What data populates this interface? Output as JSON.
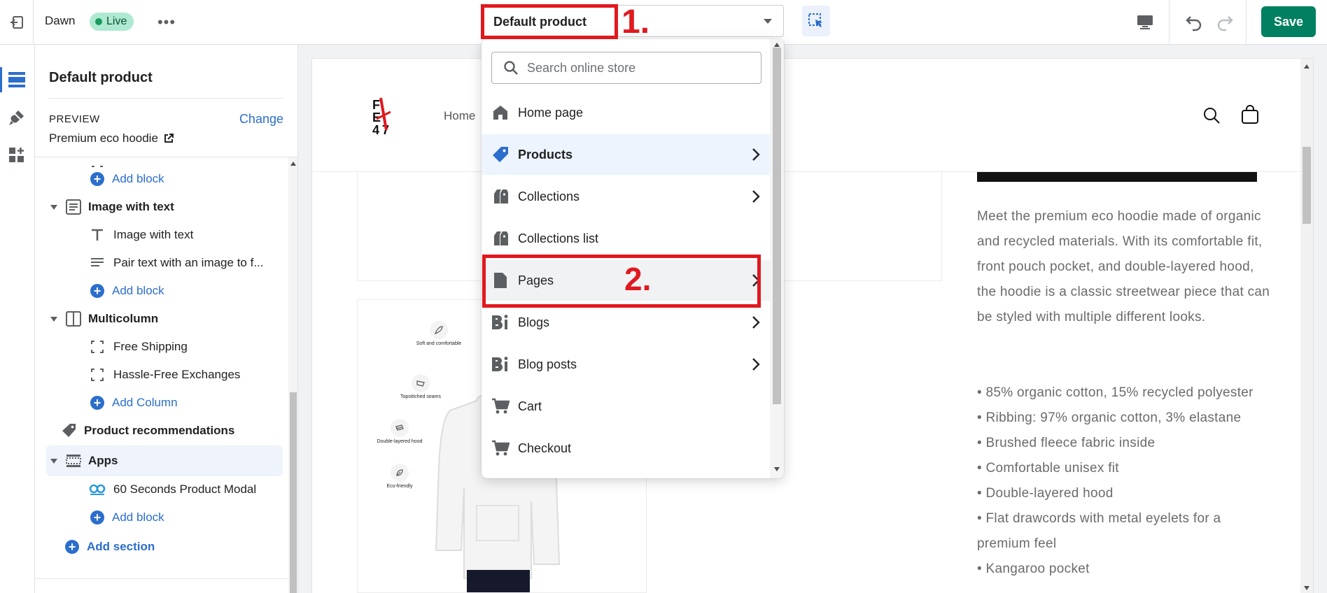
{
  "colors": {
    "accent": "#2c6ecb",
    "primary_button": "#008060",
    "annotation": "#e0191f",
    "live_badge_bg": "#aee9d1"
  },
  "topbar": {
    "theme_name": "Dawn",
    "live_badge": "Live",
    "more_icon": "more-horizontal-icon",
    "template_select": "Default product",
    "annotation_step1": "1.",
    "inspector_icon": "select-inspector-icon",
    "device_icon": "desktop-icon",
    "undo_icon": "undo-icon",
    "redo_icon": "redo-icon",
    "save_label": "Save"
  },
  "rail": {
    "items": [
      "sections-icon",
      "theme-settings-icon",
      "app-embeds-icon"
    ]
  },
  "sidebar": {
    "title": "Default product",
    "preview_caption": "PREVIEW",
    "change_label": "Change",
    "preview_value": "Premium eco hoodie",
    "tree": {
      "add_block_1": "Add block",
      "section_image_with_text": "Image with text",
      "block_image_with_text": "Image with text",
      "block_pair_text": "Pair text with an image to f...",
      "add_block_2": "Add block",
      "section_multicolumn": "Multicolumn",
      "block_free_shipping": "Free Shipping",
      "block_hassle_free": "Hassle-Free Exchanges",
      "add_column": "Add Column",
      "section_product_recommendations": "Product recommendations",
      "section_apps": "Apps",
      "block_app_modal": "60 Seconds Product Modal",
      "add_block_3": "Add block",
      "add_section": "Add section"
    }
  },
  "dropdown": {
    "search_placeholder": "Search online store",
    "items": [
      {
        "label": "Home page",
        "icon": "home-icon",
        "has_children": false
      },
      {
        "label": "Products",
        "icon": "tag-icon",
        "has_children": true
      },
      {
        "label": "Collections",
        "icon": "collections-icon",
        "has_children": true
      },
      {
        "label": "Collections list",
        "icon": "collections-list-icon",
        "has_children": false
      },
      {
        "label": "Pages",
        "icon": "page-icon",
        "has_children": true
      },
      {
        "label": "Blogs",
        "icon": "blog-icon",
        "has_children": true
      },
      {
        "label": "Blog posts",
        "icon": "blog-post-icon",
        "has_children": true
      },
      {
        "label": "Cart",
        "icon": "cart-icon",
        "has_children": false
      },
      {
        "label": "Checkout",
        "icon": "cart-icon",
        "has_children": false
      }
    ],
    "annotation_step2": "2."
  },
  "store": {
    "nav_home": "Home",
    "features": [
      "Soft and comfortable",
      "Topstitched seams",
      "Double-layered hood",
      "Eco-friendly"
    ],
    "description": "Meet the premium eco hoodie made of organic and recycled materials. With its comfortable fit, front pouch pocket, and double-layered hood, the hoodie is a classic streetwear piece that can be styled with multiple different looks.",
    "bullets": [
      "• 85% organic cotton, 15% recycled polyester",
      "• Ribbing: 97% organic cotton, 3% elastane",
      "• Brushed fleece fabric inside",
      "• Comfortable unisex fit",
      "• Double-layered hood",
      "• Flat drawcords with metal eyelets for a premium feel",
      "• Kangaroo pocket"
    ]
  }
}
